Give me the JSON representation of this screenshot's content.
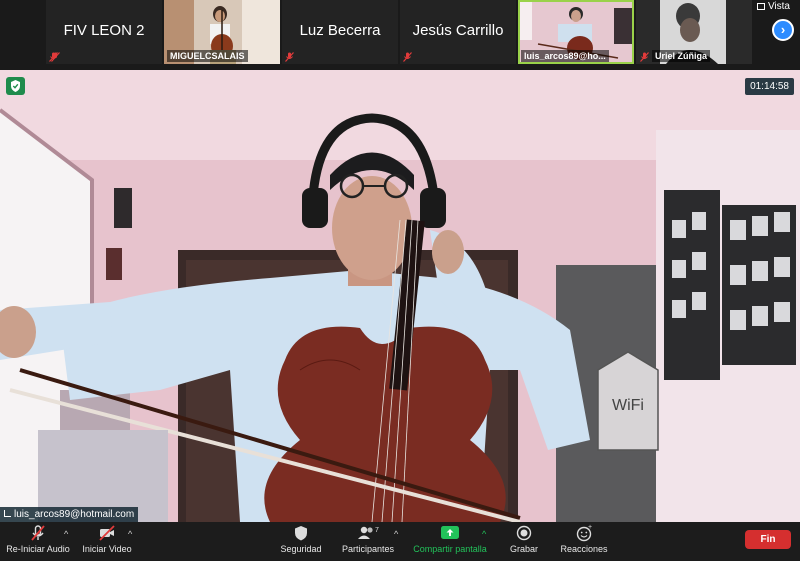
{
  "gallery": {
    "tiles": [
      {
        "name": "FIV LEON 2",
        "type": "name",
        "muted": true
      },
      {
        "name": "MIGUELCSALAIS",
        "type": "video",
        "muted": true
      },
      {
        "name": "Luz Becerra",
        "type": "name",
        "muted": true
      },
      {
        "name": "Jesús Carrillo",
        "type": "name",
        "muted": true
      },
      {
        "name": "luis_arcos89@ho...",
        "type": "video",
        "muted": false,
        "active": true
      },
      {
        "name": "Uriel Zúñiga",
        "type": "video",
        "muted": true
      }
    ],
    "view_label": "Vista"
  },
  "main": {
    "timer": "01:14:58",
    "speaker_label": "luis_arcos89@hotmail.com"
  },
  "toolbar": {
    "audio_label": "Re-Iniciar Audio",
    "video_label": "Iniciar Video",
    "security_label": "Seguridad",
    "participants_label": "Participantes",
    "participants_count": "7",
    "share_label": "Compartir pantalla",
    "record_label": "Grabar",
    "reactions_label": "Reacciones",
    "end_label": "Fin"
  },
  "colors": {
    "share_green": "#22c25a",
    "end_red": "#d52f2f",
    "active_border": "#9ad24a",
    "accent_blue": "#2d8cff"
  }
}
